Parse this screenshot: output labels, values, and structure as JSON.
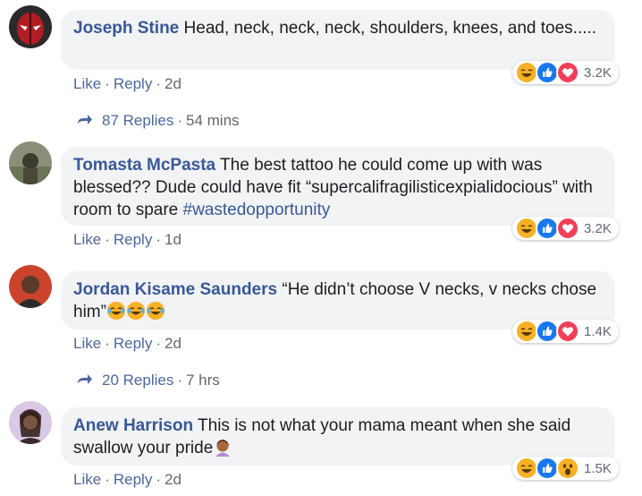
{
  "comments": [
    {
      "author": "Joseph Stine",
      "text": "Head, neck, neck, neck, shoulders, knees, and toes.....",
      "like": "Like",
      "reply": "Reply",
      "time": "2d",
      "reaction_count": "3.2K",
      "reactions": [
        "haha-icon",
        "like-icon",
        "love-icon"
      ],
      "replies_label": "87 Replies",
      "replies_time": "54 mins"
    },
    {
      "author": "Tomasta McPasta",
      "text_a": "The best tattoo he could come up with was blessed?? Dude could have fit “supercalifragilisticexpialidocious” with room to spare ",
      "hashtag": "#wastedopportunity",
      "like": "Like",
      "reply": "Reply",
      "time": "1d",
      "reaction_count": "3.2K",
      "reactions": [
        "haha-icon",
        "like-icon",
        "love-icon"
      ]
    },
    {
      "author": "Jordan Kisame Saunders",
      "text": "“He didn’t choose V necks, v necks chose him”",
      "like": "Like",
      "reply": "Reply",
      "time": "2d",
      "reaction_count": "1.4K",
      "reactions": [
        "haha-icon",
        "like-icon",
        "love-icon"
      ],
      "inline_emojis": [
        "tears-of-joy-emoji",
        "tears-of-joy-emoji",
        "tears-of-joy-emoji"
      ],
      "replies_label": "20 Replies",
      "replies_time": "7 hrs"
    },
    {
      "author": "Anew Harrison",
      "text": "This is not what your mama meant when she said swallow your pride",
      "like": "Like",
      "reply": "Reply",
      "time": "2d",
      "reaction_count": "1.5K",
      "reactions": [
        "haha-icon",
        "like-icon",
        "wow-icon"
      ],
      "inline_emojis": [
        "person-facepalming-emoji"
      ]
    }
  ],
  "colors": {
    "author": "#385898",
    "link": "#4b67a1",
    "meta": "#606770",
    "bubble": "#f2f3f5",
    "like": "#1877f2",
    "love": "#f33e58",
    "haha": "#f7b125"
  }
}
